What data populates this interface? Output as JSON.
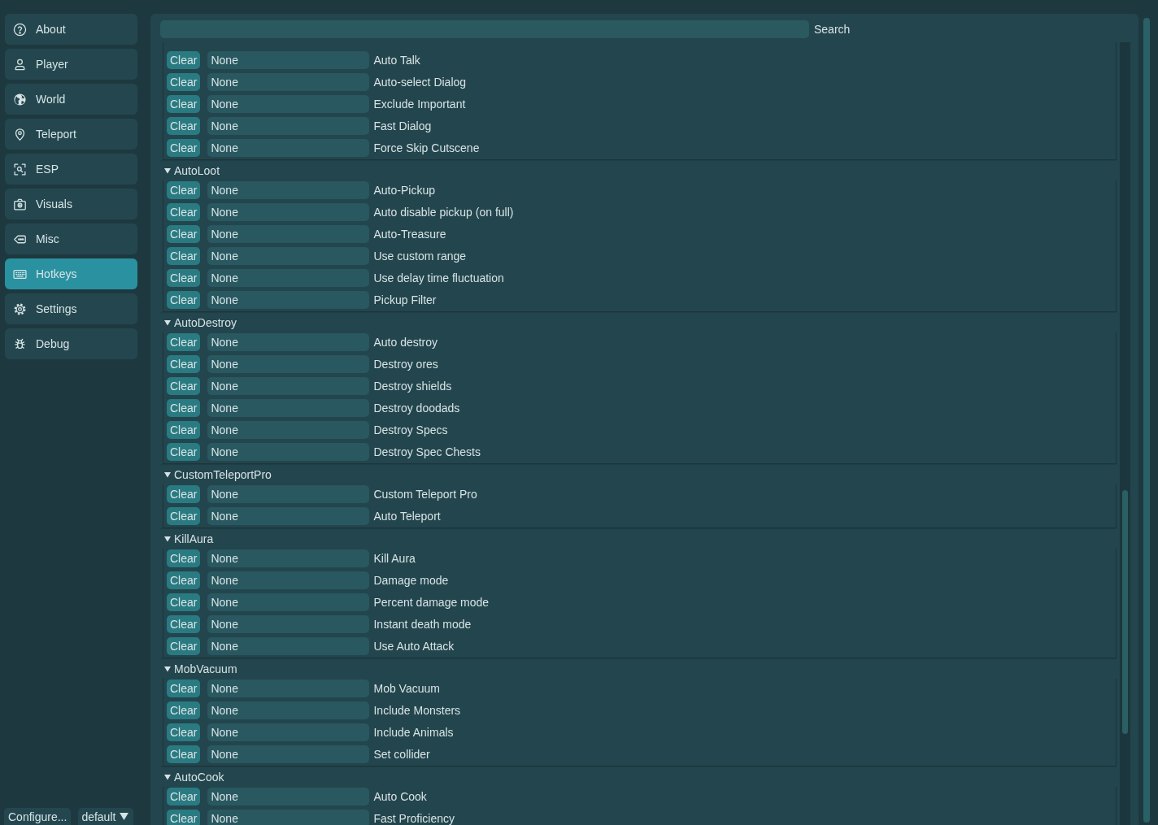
{
  "sidebar": {
    "items": [
      {
        "label": "About",
        "selected": false
      },
      {
        "label": "Player",
        "selected": false
      },
      {
        "label": "World",
        "selected": false
      },
      {
        "label": "Teleport",
        "selected": false
      },
      {
        "label": "ESP",
        "selected": false
      },
      {
        "label": "Visuals",
        "selected": false
      },
      {
        "label": "Misc",
        "selected": false
      },
      {
        "label": "Hotkeys",
        "selected": true
      },
      {
        "label": "Settings",
        "selected": false
      },
      {
        "label": "Debug",
        "selected": false
      }
    ],
    "footer": {
      "configure_button": "Configure...",
      "profile_dropdown": "default"
    }
  },
  "search": {
    "label": "Search"
  },
  "groups": [
    {
      "rows": [
        {
          "clear": "Clear",
          "binding": "None",
          "label": "Auto Talk"
        },
        {
          "clear": "Clear",
          "binding": "None",
          "label": "Auto-select Dialog"
        },
        {
          "clear": "Clear",
          "binding": "None",
          "label": "Exclude Important"
        },
        {
          "clear": "Clear",
          "binding": "None",
          "label": "Fast Dialog"
        },
        {
          "clear": "Clear",
          "binding": "None",
          "label": "Force Skip Cutscene"
        }
      ]
    },
    {
      "name": "AutoLoot",
      "expanded": true,
      "rows": [
        {
          "clear": "Clear",
          "binding": "None",
          "label": "Auto-Pickup"
        },
        {
          "clear": "Clear",
          "binding": "None",
          "label": "Auto disable pickup (on full)"
        },
        {
          "clear": "Clear",
          "binding": "None",
          "label": "Auto-Treasure"
        },
        {
          "clear": "Clear",
          "binding": "None",
          "label": "Use custom range"
        },
        {
          "clear": "Clear",
          "binding": "None",
          "label": "Use delay time fluctuation"
        },
        {
          "clear": "Clear",
          "binding": "None",
          "label": "Pickup Filter"
        }
      ]
    },
    {
      "name": "AutoDestroy",
      "expanded": true,
      "rows": [
        {
          "clear": "Clear",
          "binding": "None",
          "label": "Auto destroy"
        },
        {
          "clear": "Clear",
          "binding": "None",
          "label": "Destroy ores"
        },
        {
          "clear": "Clear",
          "binding": "None",
          "label": "Destroy shields"
        },
        {
          "clear": "Clear",
          "binding": "None",
          "label": "Destroy doodads"
        },
        {
          "clear": "Clear",
          "binding": "None",
          "label": "Destroy Specs"
        },
        {
          "clear": "Clear",
          "binding": "None",
          "label": "Destroy Spec Chests"
        }
      ]
    },
    {
      "name": "CustomTeleportPro",
      "expanded": true,
      "rows": [
        {
          "clear": "Clear",
          "binding": "None",
          "label": "Custom Teleport Pro"
        },
        {
          "clear": "Clear",
          "binding": "None",
          "label": "Auto Teleport"
        }
      ]
    },
    {
      "name": "KillAura",
      "expanded": true,
      "rows": [
        {
          "clear": "Clear",
          "binding": "None",
          "label": "Kill Aura"
        },
        {
          "clear": "Clear",
          "binding": "None",
          "label": "Damage mode"
        },
        {
          "clear": "Clear",
          "binding": "None",
          "label": "Percent damage mode"
        },
        {
          "clear": "Clear",
          "binding": "None",
          "label": "Instant death mode"
        },
        {
          "clear": "Clear",
          "binding": "None",
          "label": "Use Auto Attack"
        }
      ]
    },
    {
      "name": "MobVacuum",
      "expanded": true,
      "rows": [
        {
          "clear": "Clear",
          "binding": "None",
          "label": "Mob Vacuum"
        },
        {
          "clear": "Clear",
          "binding": "None",
          "label": "Include Monsters"
        },
        {
          "clear": "Clear",
          "binding": "None",
          "label": "Include Animals"
        },
        {
          "clear": "Clear",
          "binding": "None",
          "label": "Set collider"
        }
      ]
    },
    {
      "name": "AutoCook",
      "expanded": true,
      "rows": [
        {
          "clear": "Clear",
          "binding": "None",
          "label": "Auto Cook"
        },
        {
          "clear": "Clear",
          "binding": "None",
          "label": "Fast Proficiency"
        }
      ]
    }
  ]
}
